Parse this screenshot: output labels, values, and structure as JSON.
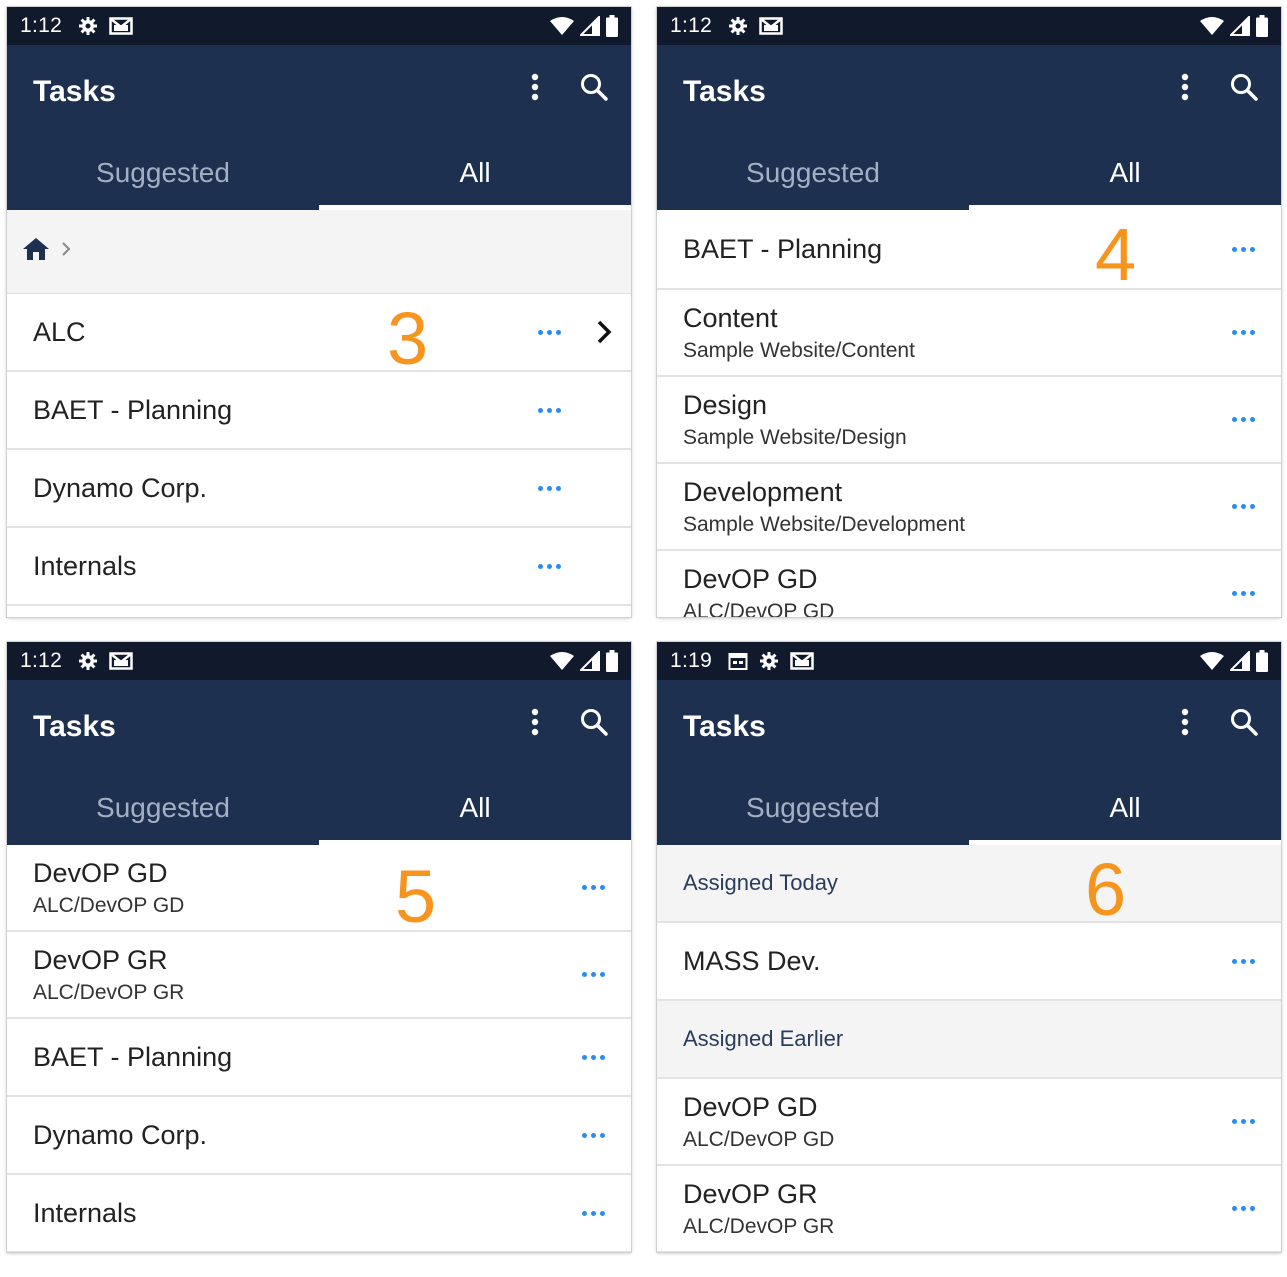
{
  "app_title": "Tasks",
  "tabs": [
    "Suggested",
    "All"
  ],
  "colors": {
    "status_bar": "#101a2c",
    "app_bar": "#1e3050",
    "accent_more": "#2a8cf0",
    "step_number": "#f7941d",
    "section_header_text": "#2a3c5c"
  },
  "screens": [
    {
      "time": "1:12",
      "status_icons": [
        "gear-icon",
        "gmail-icon"
      ],
      "step": "3",
      "active_tab": "All",
      "breadcrumb": [
        "home-icon",
        "chevron-right-icon"
      ],
      "rows": [
        {
          "title": "ALC",
          "has_chevron": true
        },
        {
          "title": "BAET - Planning"
        },
        {
          "title": "Dynamo Corp."
        },
        {
          "title": "Internals"
        }
      ]
    },
    {
      "time": "1:12",
      "status_icons": [
        "gear-icon",
        "gmail-icon"
      ],
      "step": "4",
      "active_tab": "All",
      "rows": [
        {
          "title": "BAET - Planning"
        },
        {
          "title": "Content",
          "subtitle": "Sample Website/Content"
        },
        {
          "title": "Design",
          "subtitle": "Sample Website/Design"
        },
        {
          "title": "Development",
          "subtitle": "Sample Website/Development"
        },
        {
          "title": "DevOP GD",
          "subtitle": "ALC/DevOP GD"
        }
      ]
    },
    {
      "time": "1:12",
      "status_icons": [
        "gear-icon",
        "gmail-icon"
      ],
      "step": "5",
      "active_tab": "All",
      "rows": [
        {
          "title": "DevOP GD",
          "subtitle": "ALC/DevOP GD"
        },
        {
          "title": "DevOP GR",
          "subtitle": "ALC/DevOP GR"
        },
        {
          "title": "BAET - Planning"
        },
        {
          "title": "Dynamo Corp."
        },
        {
          "title": "Internals"
        }
      ]
    },
    {
      "time": "1:19",
      "status_icons": [
        "calendar-icon",
        "gear-icon",
        "gmail-icon"
      ],
      "step": "6",
      "active_tab": "All",
      "sections": [
        {
          "header": "Assigned Today",
          "rows": [
            {
              "title": "MASS Dev."
            }
          ]
        },
        {
          "header": "Assigned Earlier",
          "rows": [
            {
              "title": "DevOP GD",
              "subtitle": "ALC/DevOP GD"
            },
            {
              "title": "DevOP GR",
              "subtitle": "ALC/DevOP GR"
            }
          ]
        }
      ]
    }
  ]
}
